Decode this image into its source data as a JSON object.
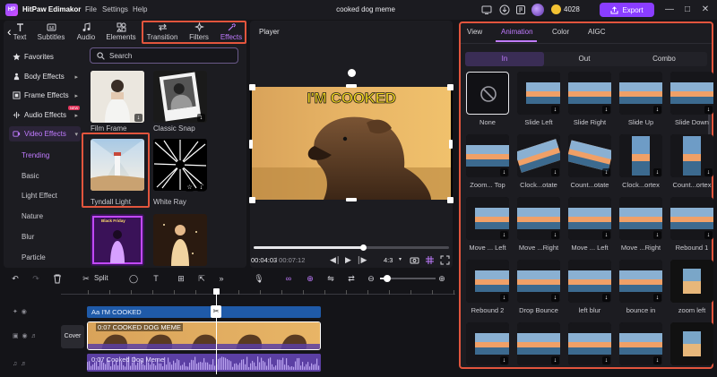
{
  "titlebar": {
    "app_name": "HitPaw Edimakor",
    "logo_text": "HP",
    "menu": [
      "File",
      "Settings",
      "Help"
    ],
    "project_title": "cooked dog meme",
    "coin_count": "4028",
    "export_label": "Export"
  },
  "top_tabs": [
    {
      "label": "Text",
      "icon": "text-icon"
    },
    {
      "label": "Subtitles",
      "icon": "subtitles-icon"
    },
    {
      "label": "Audio",
      "icon": "audio-icon"
    },
    {
      "label": "Elements",
      "icon": "elements-icon"
    },
    {
      "label": "Transition",
      "icon": "transition-icon"
    },
    {
      "label": "Filters",
      "icon": "filters-icon"
    },
    {
      "label": "Effects",
      "icon": "effects-icon",
      "active": true
    }
  ],
  "sidebar": {
    "categories": [
      {
        "label": "Favorites",
        "icon": "star-icon"
      },
      {
        "label": "Body Effects",
        "icon": "body-effects-icon"
      },
      {
        "label": "Frame Effects",
        "icon": "frame-effects-icon"
      },
      {
        "label": "Audio Effects",
        "icon": "audio-effects-icon",
        "badge": "NEW"
      },
      {
        "label": "Video Effects",
        "icon": "video-effects-icon",
        "active": true
      }
    ],
    "subcategories": [
      {
        "label": "Trending",
        "active": true
      },
      {
        "label": "Basic"
      },
      {
        "label": "Light Effect"
      },
      {
        "label": "Nature"
      },
      {
        "label": "Blur"
      },
      {
        "label": "Particle"
      }
    ]
  },
  "search": {
    "placeholder": "Search"
  },
  "effects": [
    {
      "label": "Film Frame"
    },
    {
      "label": "Classic Snap"
    },
    {
      "label": "Tyndall Light",
      "selected": true
    },
    {
      "label": "White Ray"
    },
    {
      "label": "Black Friday"
    },
    {
      "label": ""
    }
  ],
  "player": {
    "label": "Player",
    "overlay_text": "I'M COOKED",
    "time_current": "00:04:03",
    "time_total": "/ 00:07:12",
    "aspect_ratio": "4:3",
    "progress": 0.56
  },
  "right_panel": {
    "tabs": [
      {
        "label": "View"
      },
      {
        "label": "Animation",
        "active": true
      },
      {
        "label": "Color"
      },
      {
        "label": "AIGC"
      }
    ],
    "sub_tabs": [
      {
        "label": "In",
        "active": true
      },
      {
        "label": "Out"
      },
      {
        "label": "Combo"
      }
    ],
    "animations": [
      {
        "label": "None"
      },
      {
        "label": "Slide Left"
      },
      {
        "label": "Slide Right"
      },
      {
        "label": "Slide Up"
      },
      {
        "label": "Slide Down"
      },
      {
        "label": "Zoom... Top"
      },
      {
        "label": "Clock...otate"
      },
      {
        "label": "Count...otate"
      },
      {
        "label": "Clock...ortex"
      },
      {
        "label": "Count...ortex"
      },
      {
        "label": "Move ... Left"
      },
      {
        "label": "Move ...Right"
      },
      {
        "label": "Move ... Left"
      },
      {
        "label": "Move ...Right"
      },
      {
        "label": "Rebound 1"
      },
      {
        "label": "Rebound 2"
      },
      {
        "label": "Drop Bounce"
      },
      {
        "label": "left blur"
      },
      {
        "label": "bounce in"
      },
      {
        "label": "zoom left"
      },
      {
        "label": ""
      },
      {
        "label": ""
      },
      {
        "label": ""
      },
      {
        "label": ""
      },
      {
        "label": ""
      }
    ]
  },
  "timeline": {
    "split_label": "Split",
    "text_track": "I'M COOKED",
    "video_track": "0:07 COOKED DOG MEME",
    "audio_track": "0:07 Cooked Dog Meme",
    "cover_label": "Cover"
  },
  "colors": {
    "accent": "#c07bff",
    "export": "#8a3dff",
    "highlight": "#e2553d",
    "text_track": "#1f5aa8",
    "audio_track": "#5b3fa3"
  }
}
